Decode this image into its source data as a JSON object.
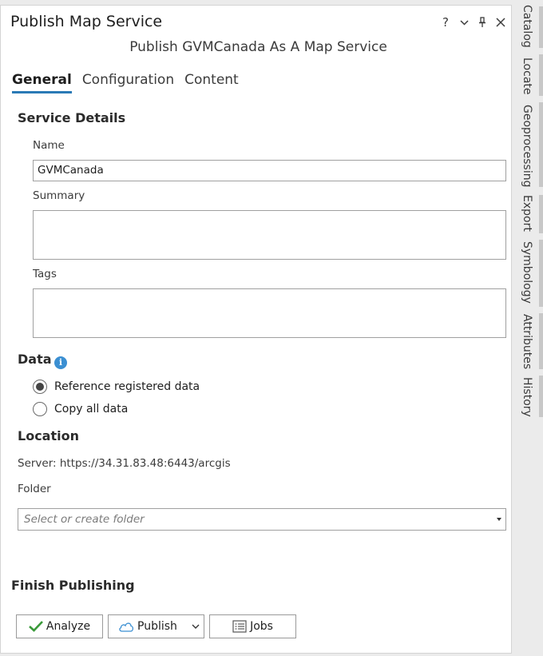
{
  "pane": {
    "title": "Publish Map Service",
    "subtitle": "Publish GVMCanada As A Map Service",
    "controls": {
      "help": "?",
      "menu": "⌄",
      "pin": "⚑",
      "close": "✕"
    }
  },
  "tabs": [
    {
      "label": "General"
    },
    {
      "label": "Configuration"
    },
    {
      "label": "Content"
    }
  ],
  "service_details": {
    "heading": "Service Details",
    "name_label": "Name",
    "name_value": "GVMCanada",
    "summary_label": "Summary",
    "summary_value": "",
    "tags_label": "Tags",
    "tags_value": ""
  },
  "data_section": {
    "heading": "Data",
    "info_glyph": "i",
    "options": [
      {
        "label": "Reference registered data",
        "selected": true
      },
      {
        "label": "Copy all data",
        "selected": false
      }
    ]
  },
  "location": {
    "heading": "Location",
    "server": "Server: https://34.31.83.48:6443/arcgis",
    "folder_label": "Folder",
    "folder_placeholder": "Select or create folder"
  },
  "finish": {
    "heading": "Finish Publishing",
    "analyze_label": "Analyze",
    "publish_label": "Publish",
    "jobs_label": "Jobs"
  },
  "sidebar": [
    {
      "label": "Catalog"
    },
    {
      "label": "Locate"
    },
    {
      "label": "Geoprocessing"
    },
    {
      "label": "Export"
    },
    {
      "label": "Symbology"
    },
    {
      "label": "Attributes"
    },
    {
      "label": "History"
    }
  ],
  "colors": {
    "accent": "#2a7ab6",
    "info": "#3b8fd2",
    "check": "#3a9a3a",
    "cloud": "#3b8fd2"
  }
}
